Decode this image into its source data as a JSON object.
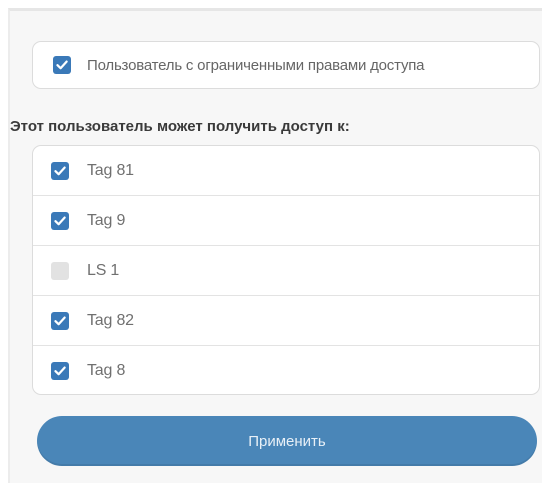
{
  "restricted_access": {
    "label": "Пользователь с ограниченными правами доступа",
    "checked": true
  },
  "access_heading": "Этот пользователь может получить доступ к:",
  "tags": [
    {
      "label": "Tag 81",
      "checked": true
    },
    {
      "label": "Tag 9",
      "checked": true
    },
    {
      "label": "LS 1",
      "checked": false
    },
    {
      "label": "Tag 82",
      "checked": true
    },
    {
      "label": "Tag 8",
      "checked": true
    }
  ],
  "apply_button": {
    "label": "Применить"
  },
  "colors": {
    "checkbox_checked": "#3a79b8",
    "checkbox_unchecked": "#e2e2e2",
    "button": "#4a86b8"
  }
}
